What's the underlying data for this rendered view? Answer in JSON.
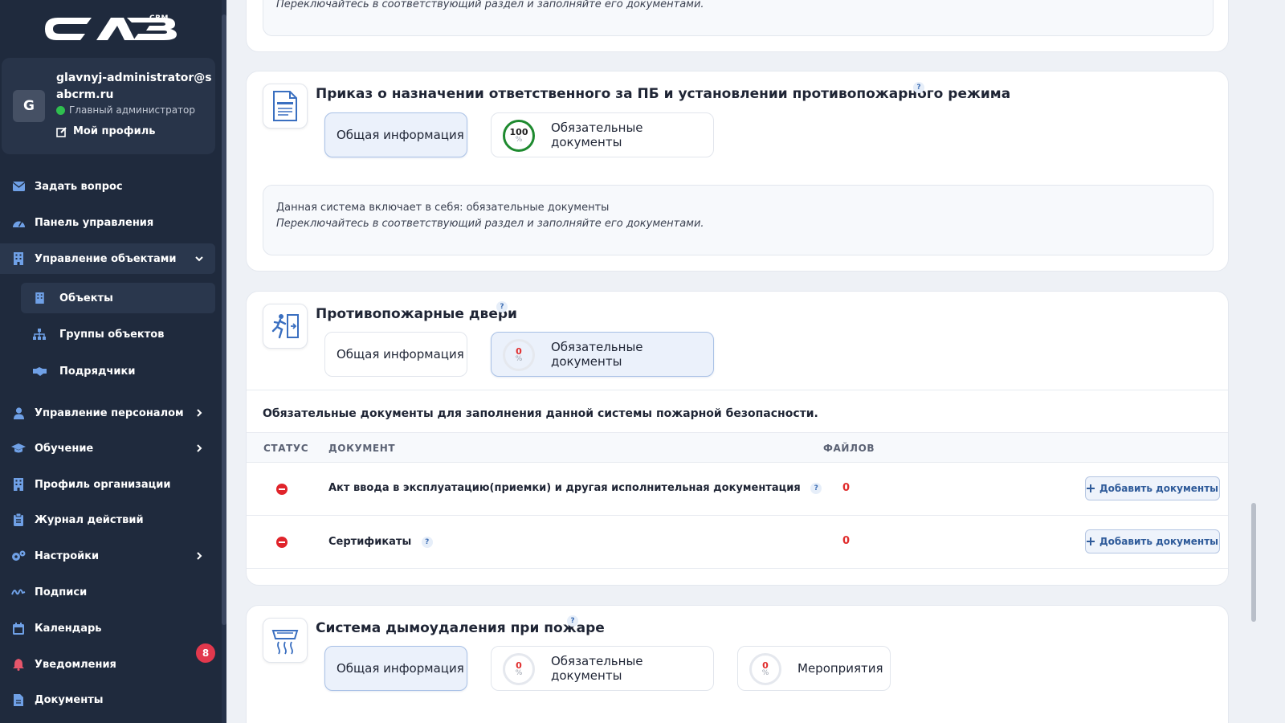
{
  "app": {
    "logo_suffix": "CRM"
  },
  "profile": {
    "avatar_letter": "G",
    "email": "glavnyj-administrator@sabcrm.ru",
    "role": "Главный администратор",
    "profile_link": "Мой профиль",
    "status_color": "#2fbf4f"
  },
  "nav": {
    "ask": "Задать вопрос",
    "dashboard": "Панель управления",
    "objects_mgmt": "Управление объектами",
    "objects": "Объекты",
    "object_groups": "Группы объектов",
    "contractors": "Подрядчики",
    "staff": "Управление персоналом",
    "training": "Обучение",
    "org_profile": "Профиль организации",
    "journal": "Журнал действий",
    "settings": "Настройки",
    "signatures": "Подписи",
    "calendar": "Календарь",
    "notifications": "Уведомления",
    "notifications_count": "8",
    "documents": "Документы"
  },
  "top_card": {
    "hint": "Переключайтесь в соответствующий раздел и заполняйте его документами."
  },
  "systems": [
    {
      "title": "Приказ о назначении ответственного за ПБ и установлении противопожарного режима",
      "help": "?",
      "tab_general": "Общая информация",
      "tab_required": "Обязательные документы",
      "required_pct": "100",
      "pct_sign": "%",
      "info_line1": "Данная система включает в себя: обязательные документы",
      "info_line2": "Переключайтесь в соответствующий раздел и заполняйте его документами."
    },
    {
      "title": "Противопожарные двери",
      "help": "?",
      "tab_general": "Общая информация",
      "tab_required": "Обязательные документы",
      "required_pct": "0",
      "pct_sign": "%",
      "section_heading": "Обязательные документы для заполнения данной системы пожарной безопасности.",
      "table": {
        "headers": [
          "СТАТУС",
          "ДОКУМЕНТ",
          "ФАЙЛОВ"
        ],
        "rows": [
          {
            "document": "Акт ввода в эксплуатацию(приемки) и другая исполнительная документация",
            "files": "0",
            "action": "Добавить документы"
          },
          {
            "document": "Сертификаты",
            "files": "0",
            "action": "Добавить документы"
          }
        ]
      }
    },
    {
      "title": "Система дымоудаления при пожаре",
      "help": "?",
      "tab_general": "Общая информация",
      "tab_required": "Обязательные документы",
      "required_pct": "0",
      "tab_events": "Мероприятия",
      "events_pct": "0",
      "pct_sign": "%"
    }
  ]
}
